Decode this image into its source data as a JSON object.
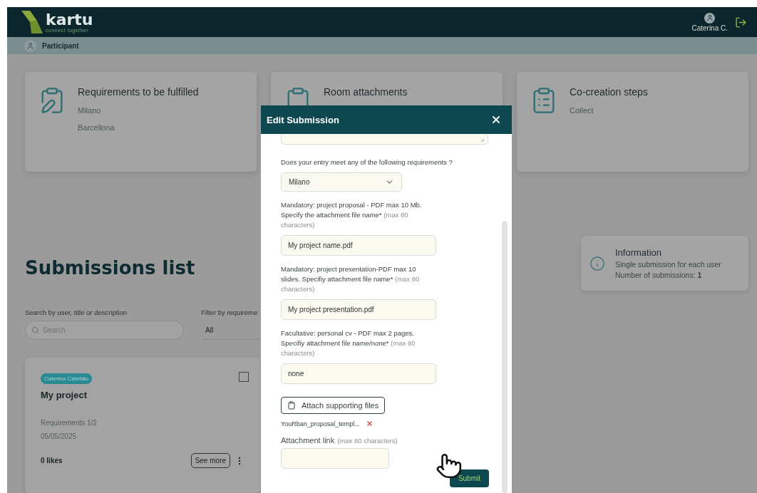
{
  "header": {
    "logo": {
      "name": "kartu",
      "tagline": "connect together"
    },
    "user": {
      "name": "Caterina C."
    }
  },
  "role_bar": {
    "label": "Participant"
  },
  "summary_cards": [
    {
      "kind": "requirements",
      "title": "Requirements to be fulfilled",
      "items": [
        "Milano",
        "Barcellona"
      ]
    },
    {
      "kind": "attachments",
      "title": "Room attachments"
    },
    {
      "kind": "steps",
      "title": "Co-creation steps",
      "items": [
        "Collect"
      ]
    }
  ],
  "submissions": {
    "title": "Submissions list",
    "search": {
      "label": "Search by user, title or description",
      "placeholder": "Search"
    },
    "filter": {
      "label": "Filter by requireme",
      "value": "All"
    },
    "items": [
      {
        "author": "Caterina Calefato",
        "title": "My project",
        "requirements": "Requirements 1/2",
        "date": "05/05/2025",
        "likes": "0 likes",
        "checked": false,
        "action": "See more"
      }
    ]
  },
  "information": {
    "title": "Information",
    "lines": [
      "Single submission for each user",
      "Number of submissions: **1**"
    ]
  },
  "modal": {
    "title": "Edit Submission",
    "fields": [
      {
        "kind": "textarea"
      },
      {
        "kind": "select",
        "label": "Does your entry meet any of the following requirements ?",
        "value": "Milano"
      },
      {
        "kind": "text",
        "label": "Mandatory: project proposal - PDF max 10 Mb. Specify the attachment file name*",
        "hint": "(max 80 characters)",
        "value": "My project name.pdf"
      },
      {
        "kind": "text",
        "label": "Mandatory: project presentation-PDF max 10 slides. Specifiy attachment file name*",
        "hint": "(max 80 characters)",
        "value": "My project presentation.pdf"
      },
      {
        "kind": "text",
        "label": "Facultative: personal cv - PDF max 2 pages. Specifiy attachment file name/none*",
        "hint": "(max 80 characters)",
        "value": "none"
      }
    ],
    "attach_button": "Attach supporting files",
    "attachments": [
      {
        "name": "YouRban_proposal_templ..."
      }
    ],
    "link": {
      "label": "Attachment link",
      "hint": "(max 80 characters)"
    },
    "submit": "Submit"
  }
}
